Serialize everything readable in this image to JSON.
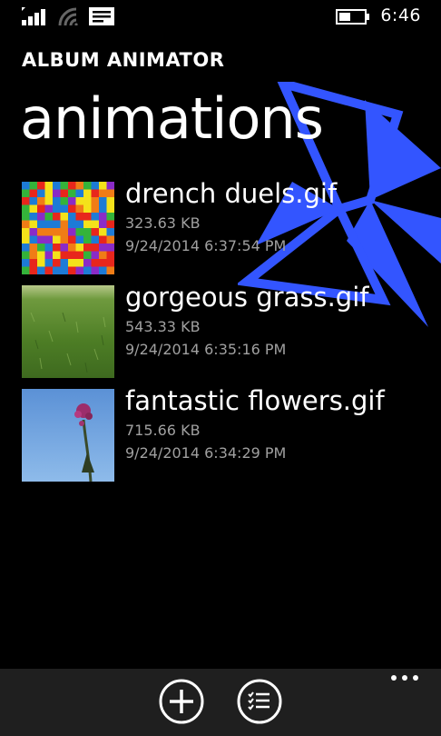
{
  "status_bar": {
    "time": "6:46",
    "icons": [
      "signal-icon",
      "wifi-icon",
      "message-icon",
      "battery-icon"
    ]
  },
  "header": {
    "app_title": "ALBUM ANIMATOR",
    "page_title": "animations"
  },
  "files": [
    {
      "name": "drench duels.gif",
      "size": "323.63 KB",
      "date": "9/24/2014 6:37:54 PM",
      "thumbnail": "colorful-grid"
    },
    {
      "name": "gorgeous grass.gif",
      "size": "543.33 KB",
      "date": "9/24/2014 6:35:16 PM",
      "thumbnail": "grass"
    },
    {
      "name": "fantastic flowers.gif",
      "size": "715.66 KB",
      "date": "9/24/2014 6:34:29 PM",
      "thumbnail": "flower-sky"
    }
  ],
  "app_bar": {
    "buttons": [
      "add-icon",
      "select-list-icon"
    ],
    "more": "ellipsis-icon"
  },
  "colors": {
    "background": "#000000",
    "accent": "#3355ff",
    "app_bar": "#1f1f1f",
    "secondary_text": "#a0a0a0"
  }
}
